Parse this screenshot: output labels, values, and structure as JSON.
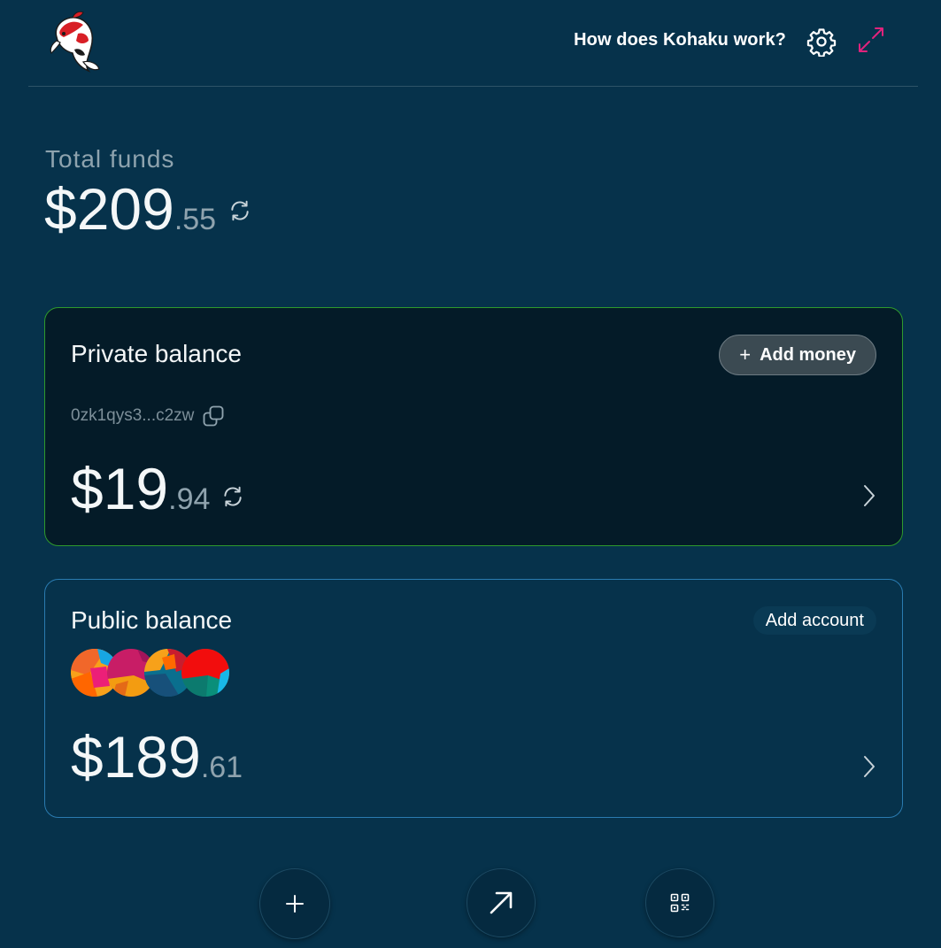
{
  "header": {
    "help_link": "How does Kohaku work?",
    "logo": "koi-fish-logo",
    "icons": {
      "settings": "gear-icon",
      "expand": "expand-arrows-icon"
    },
    "accent_color": "#e0237c"
  },
  "total": {
    "label": "Total funds",
    "amount_int": "$209",
    "amount_dec": ".55"
  },
  "private_card": {
    "title": "Private balance",
    "add_money_label": "Add money",
    "address": "0zk1qys3...c2zw",
    "amount_int": "$19",
    "amount_dec": ".94",
    "border_color": "#2e9a2c"
  },
  "public_card": {
    "title": "Public balance",
    "add_account_label": "Add account",
    "amount_int": "$189",
    "amount_dec": ".61",
    "border_color": "#2a7bb0",
    "tokens": [
      "token-avatar-1",
      "token-avatar-2",
      "token-avatar-3",
      "token-avatar-4"
    ]
  },
  "actions": [
    {
      "name": "add-action-button",
      "icon": "plus-icon"
    },
    {
      "name": "send-action-button",
      "icon": "arrow-up-right-icon"
    },
    {
      "name": "receive-action-button",
      "icon": "qr-code-icon"
    }
  ]
}
